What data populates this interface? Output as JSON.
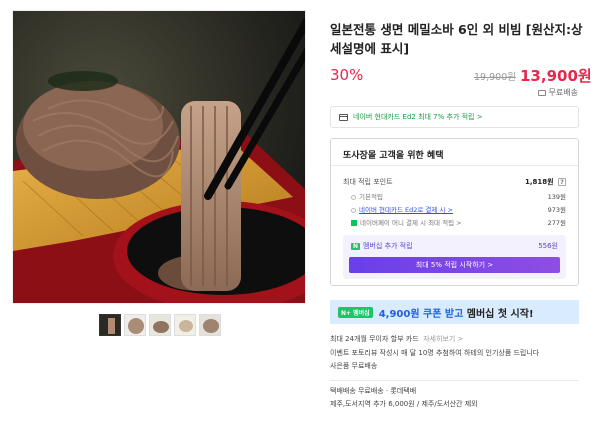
{
  "product": {
    "title": "일본전통 생면 메밀소바 6인 외 비빔 [원산지:상세설명에 표시]",
    "discount": "30%",
    "original_price": "19,900원",
    "price": "13,900원",
    "shipping": "무료배송"
  },
  "card_banner": "네이버 현대카드 Ed2 최대 7% 추가 적립 >",
  "benefits": {
    "header": "또사장몰 고객을 위한 혜택",
    "max_points_label": "최대 적립 포인트",
    "max_points_value": "1,818원",
    "qmark": "?",
    "rows": [
      {
        "label": "기본적립",
        "value": "139원"
      },
      {
        "label": "네이버 현대카드 Ed2로 결제 시 >",
        "value": "973원"
      },
      {
        "label": "네이버페이 머니 결제 시 최대 적립 >",
        "value": "277원"
      }
    ],
    "member": {
      "badge": "N",
      "label": "멤버십 추가 적립",
      "value": "556원",
      "button": "최대 5% 적립 시작하기 >"
    }
  },
  "coupon": {
    "badge": "N+ 멤버십",
    "text_highlight": "4,900원 쿠폰 받고",
    "text_rest": " 멤버십 첫 시작!"
  },
  "extra": {
    "installment": "최대 24개월 무이자 할부 카드",
    "installment_link": "자세히보기 >",
    "event": "이벤트  포토리뷰 작성시 매 달 10명 추첨하여 하테의 인기상품 드립니다",
    "gift": "사은품  무료배송",
    "delivery": "택배배송   무료배송 · 롯데택배",
    "delivery_extra": "제주,도서지역 추가 6,000원 / 제주/도서산간 제외"
  },
  "colors": {
    "accent_red": "#e5284d",
    "naver_green": "#1ec46b",
    "member_purple": "#6a3fe8"
  }
}
